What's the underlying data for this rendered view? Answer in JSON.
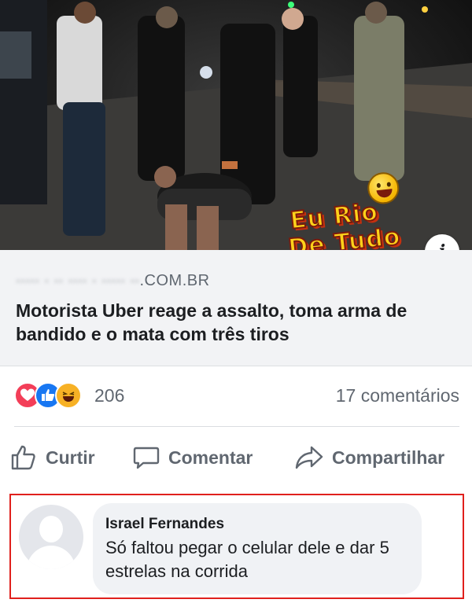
{
  "photo": {
    "watermark_line1": "Eu Rio",
    "watermark_line2": "De Tudo",
    "info_button_label": "i"
  },
  "link_preview": {
    "domain_obscured": "∙∙∙∙∙ ∙ ∙∙ ∙∙∙∙ ∙ ∙∙∙∙∙ ∙∙",
    "domain_suffix": ".COM.BR",
    "title": "Motorista Uber reage a assalto, toma arma de bandido e o mata com três tiros"
  },
  "reactions": {
    "icons": [
      "love-icon",
      "like-icon",
      "haha-icon"
    ],
    "count": "206",
    "comments_label": "17 comentários"
  },
  "actions": {
    "like_label": "Curtir",
    "comment_label": "Comentar",
    "share_label": "Compartilhar"
  },
  "comment": {
    "author": "Israel Fernandes",
    "text": "Só faltou pegar o celular dele e dar 5 estrelas na corrida"
  },
  "colors": {
    "love": "#f33e58",
    "like": "#1877f2",
    "haha": "#f7b125",
    "highlight_frame": "#e0201c",
    "meta_text": "#606770"
  }
}
